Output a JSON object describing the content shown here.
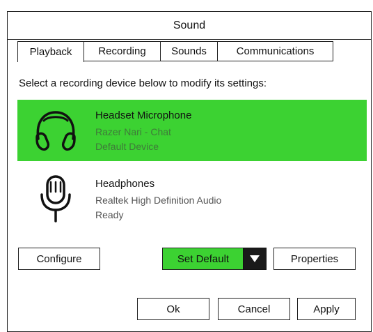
{
  "window": {
    "title": "Sound"
  },
  "tabs": [
    {
      "label": "Playback"
    },
    {
      "label": "Recording"
    },
    {
      "label": "Sounds"
    },
    {
      "label": "Communications"
    }
  ],
  "instructions": "Select a recording device below to modify its settings:",
  "devices": [
    {
      "name": "Headset Microphone",
      "driver": "Razer Nari - Chat",
      "status": "Default Device",
      "icon": "headset-icon",
      "selected": true
    },
    {
      "name": "Headphones",
      "driver": "Realtek High Definition Audio",
      "status": "Ready",
      "icon": "microphone-icon",
      "selected": false
    }
  ],
  "buttons": {
    "configure": "Configure",
    "set_default": "Set Default",
    "properties": "Properties",
    "ok": "Ok",
    "cancel": "Cancel",
    "apply": "Apply"
  },
  "colors": {
    "selected_bg": "#3cd232",
    "set_default_bg": "#3cd232",
    "dropdown_bg": "#1a1a1a"
  }
}
